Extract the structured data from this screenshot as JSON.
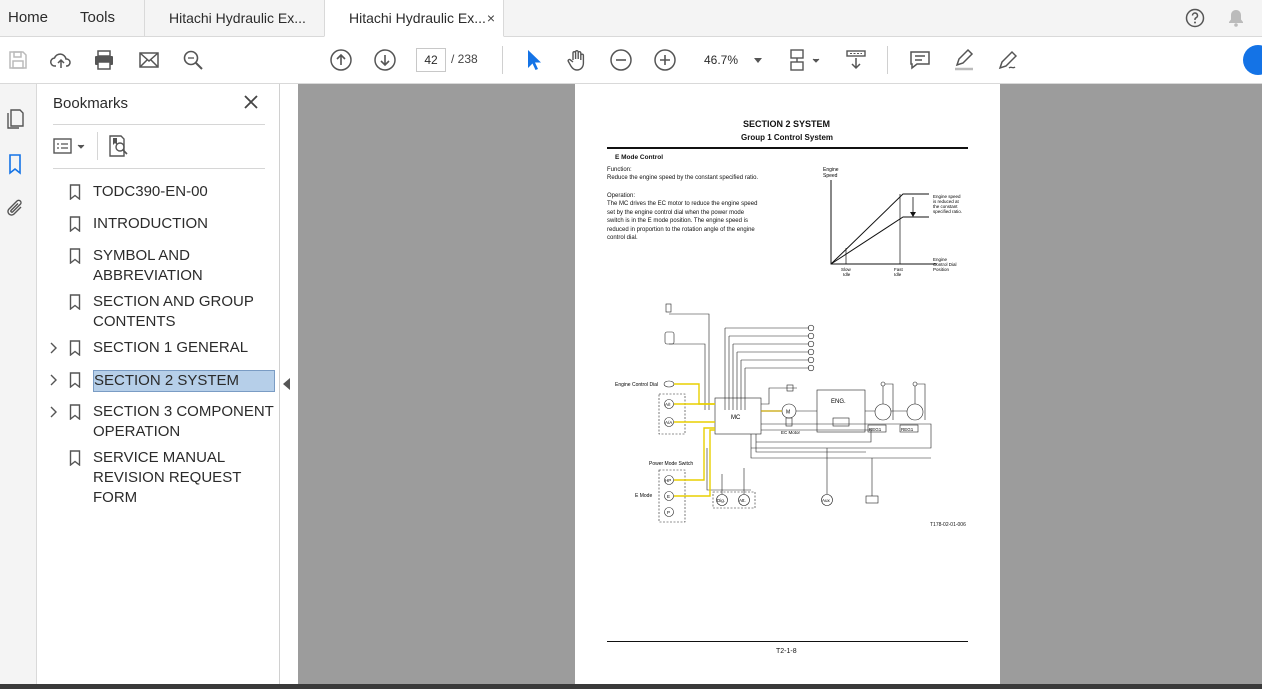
{
  "menu": {
    "home": "Home",
    "tools": "Tools"
  },
  "tabs": [
    {
      "label": "Hitachi Hydraulic Ex..."
    },
    {
      "label": "Hitachi Hydraulic Ex...",
      "close": "×"
    }
  ],
  "toolbar": {
    "page_current": "42",
    "page_total": "/ 238",
    "zoom": "46.7%"
  },
  "bookmarks": {
    "title": "Bookmarks",
    "items": [
      {
        "label": "TODC390-EN-00",
        "expandable": false
      },
      {
        "label": "INTRODUCTION",
        "expandable": false
      },
      {
        "label": "SYMBOL AND ABBREVIATION",
        "expandable": false
      },
      {
        "label": "SECTION AND GROUP CONTENTS",
        "expandable": false
      },
      {
        "label": "SECTION 1 GENERAL",
        "expandable": true
      },
      {
        "label": "SECTION 2 SYSTEM",
        "expandable": true,
        "selected": true
      },
      {
        "label": "SECTION 3 COMPONENT OPERATION",
        "expandable": true
      },
      {
        "label": "SERVICE MANUAL REVISION REQUEST FORM",
        "expandable": false
      }
    ]
  },
  "document": {
    "section": "SECTION 2 SYSTEM",
    "group": "Group 1 Control System",
    "heading": "E Mode Control",
    "function_label": "Function:",
    "function_text": "Reduce the engine speed by the constant specified ratio.",
    "operation_label": "Operation:",
    "operation_lines": [
      "The MC drives the EC motor to reduce the engine speed",
      "set by the engine control dial when the power mode",
      "switch is in the E mode position. The engine speed is",
      "reduced in proportion to the rotation angle of the engine",
      "control dial."
    ],
    "graph": {
      "y_label": [
        "Engine",
        "Speed"
      ],
      "x_label": [
        "Engine",
        "Control Dial",
        "Position"
      ],
      "slow": [
        "Slow",
        "Idle"
      ],
      "fast": [
        "Fast",
        "Idle"
      ],
      "note": [
        "Engine speed",
        "is reduced at",
        "the constant",
        "specified ratio."
      ]
    },
    "diagram": {
      "dial": "Engine Control Dial",
      "mc": "MC",
      "eng": "ENG.",
      "m": "M",
      "ec_motor": "EC Motor",
      "reg1": "REG1",
      "reg2": "REG1",
      "ai": "A/I",
      "aa": "A/A",
      "power_mode": "Power Mode Switch",
      "hp": "HP",
      "e": "E",
      "p": "P",
      "emode": "E Mode",
      "dig": "Dig.",
      "att": "Att.",
      "aux": "Aux",
      "fig_id": "T178-02-01-006"
    },
    "footer": "T2-1-8"
  }
}
